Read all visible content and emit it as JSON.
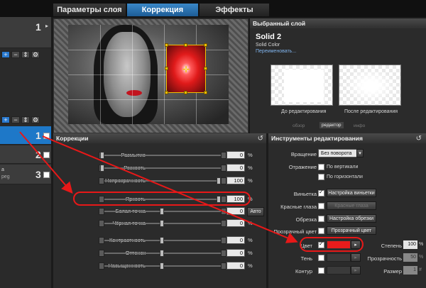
{
  "top_tabs": [
    "Параметры слоя",
    "Коррекция",
    "Эффекты"
  ],
  "left": {
    "rows": [
      {
        "num": "1"
      },
      {
        "num": "1"
      },
      {
        "num": "2"
      },
      {
        "num": "3",
        "name": "а",
        "sub": "peg"
      }
    ],
    "toolbar_plus": "+",
    "toolbar_minus": "−",
    "toolbar_updown": "⇕",
    "toolbar_gear": "⚙"
  },
  "selected_layer": {
    "header": "Выбранный слой",
    "name": "Solid 2",
    "type": "Solid Color",
    "rename": "Переименовать...",
    "before": "До редактирования",
    "after": "После редактирования",
    "mode_overview": "обзор",
    "mode_editor": "редактор",
    "mode_info": "инфо"
  },
  "corrections": {
    "header": "Коррекции",
    "rows": [
      {
        "label": "Размытие",
        "value": "0",
        "unit": "%"
      },
      {
        "label": "Резкость",
        "value": "0",
        "unit": "%"
      },
      {
        "label": "Непрозрачность",
        "value": "100",
        "unit": "%"
      },
      {
        "label": "Яркость",
        "value": "100",
        "unit": "%"
      },
      {
        "label": "Белая точка",
        "value": "0",
        "unit": "%"
      },
      {
        "label": "Чёрная точка",
        "value": "0",
        "unit": "%"
      },
      {
        "label": "Контрастность",
        "value": "0",
        "unit": "%"
      },
      {
        "label": "Оттенок",
        "value": "0",
        "unit": "%"
      },
      {
        "label": "Насыщенность",
        "value": "0",
        "unit": "%"
      }
    ],
    "auto_button": "Авто"
  },
  "tools": {
    "header": "Инструменты редактирования",
    "rotate_label": "Вращение",
    "rotate_value": "Без поворота",
    "mirror_label": "Отражение",
    "mirror_vertical": "По вертикали",
    "mirror_horizontal": "По горизонтали",
    "vignette_label": "Виньетка",
    "vignette_button": "Настройка виньетки",
    "redeye_label": "Красные глаза",
    "redeye_button": "Красные глаза",
    "crop_label": "Обрезка",
    "crop_button": "Настройка обрезки",
    "transp_label": "Прозрачный цвет",
    "transp_button": "Прозрачный цвет",
    "color_label": "Цвет",
    "color_value": "#e81c1c",
    "degree_label": "Степень",
    "degree_value": "100",
    "degree_unit": "%",
    "shadow_label": "Тень",
    "opacity_label": "Прозрачность",
    "opacity_value": "50",
    "opacity_unit": "%",
    "contour_label": "Контур",
    "size_label": "Размер",
    "size_value": "1",
    "size_unit": "#"
  }
}
